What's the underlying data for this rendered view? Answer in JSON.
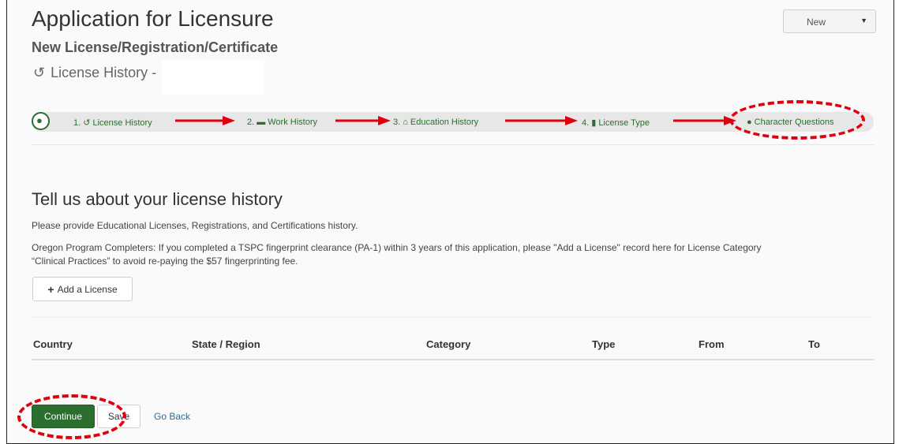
{
  "page": {
    "title": "Application for Licensure",
    "subtitle": "New License/Registration/Certificate",
    "section_label": "License History -",
    "section_icon": "history-icon"
  },
  "type_select": {
    "value": "New"
  },
  "progress": {
    "steps": [
      {
        "label": "1.",
        "icon": "history-icon",
        "text": "License History"
      },
      {
        "label": "2.",
        "icon": "briefcase-icon",
        "text": "Work History"
      },
      {
        "label": "3.",
        "icon": "graduation-cap-icon",
        "text": "Education History"
      },
      {
        "label": "4.",
        "icon": "bookmark-icon",
        "text": "License Type"
      },
      {
        "label": "",
        "icon": "comment-icon",
        "text": "Character Questions"
      }
    ]
  },
  "content": {
    "heading": "Tell us about your license history",
    "intro": "Please provide Educational Licenses, Registrations, and Certifications history.",
    "note_line1": "Oregon Program Completers: If you completed a TSPC fingerprint clearance (PA-1) within 3 years of this application, please \"Add a License\" record here for License Category",
    "note_line2": "“Clinical Practices” to avoid re-paying the $57 fingerprinting fee.",
    "add_button": "Add a License"
  },
  "table": {
    "headers": [
      "Country",
      "State / Region",
      "Category",
      "Type",
      "From",
      "To"
    ]
  },
  "actions": {
    "continue": "Continue",
    "save": "Save",
    "back": "Go Back"
  },
  "colors": {
    "primary_green": "#2c6e2f",
    "annotation_red": "#e0000d",
    "link_blue": "#2a6f95"
  }
}
